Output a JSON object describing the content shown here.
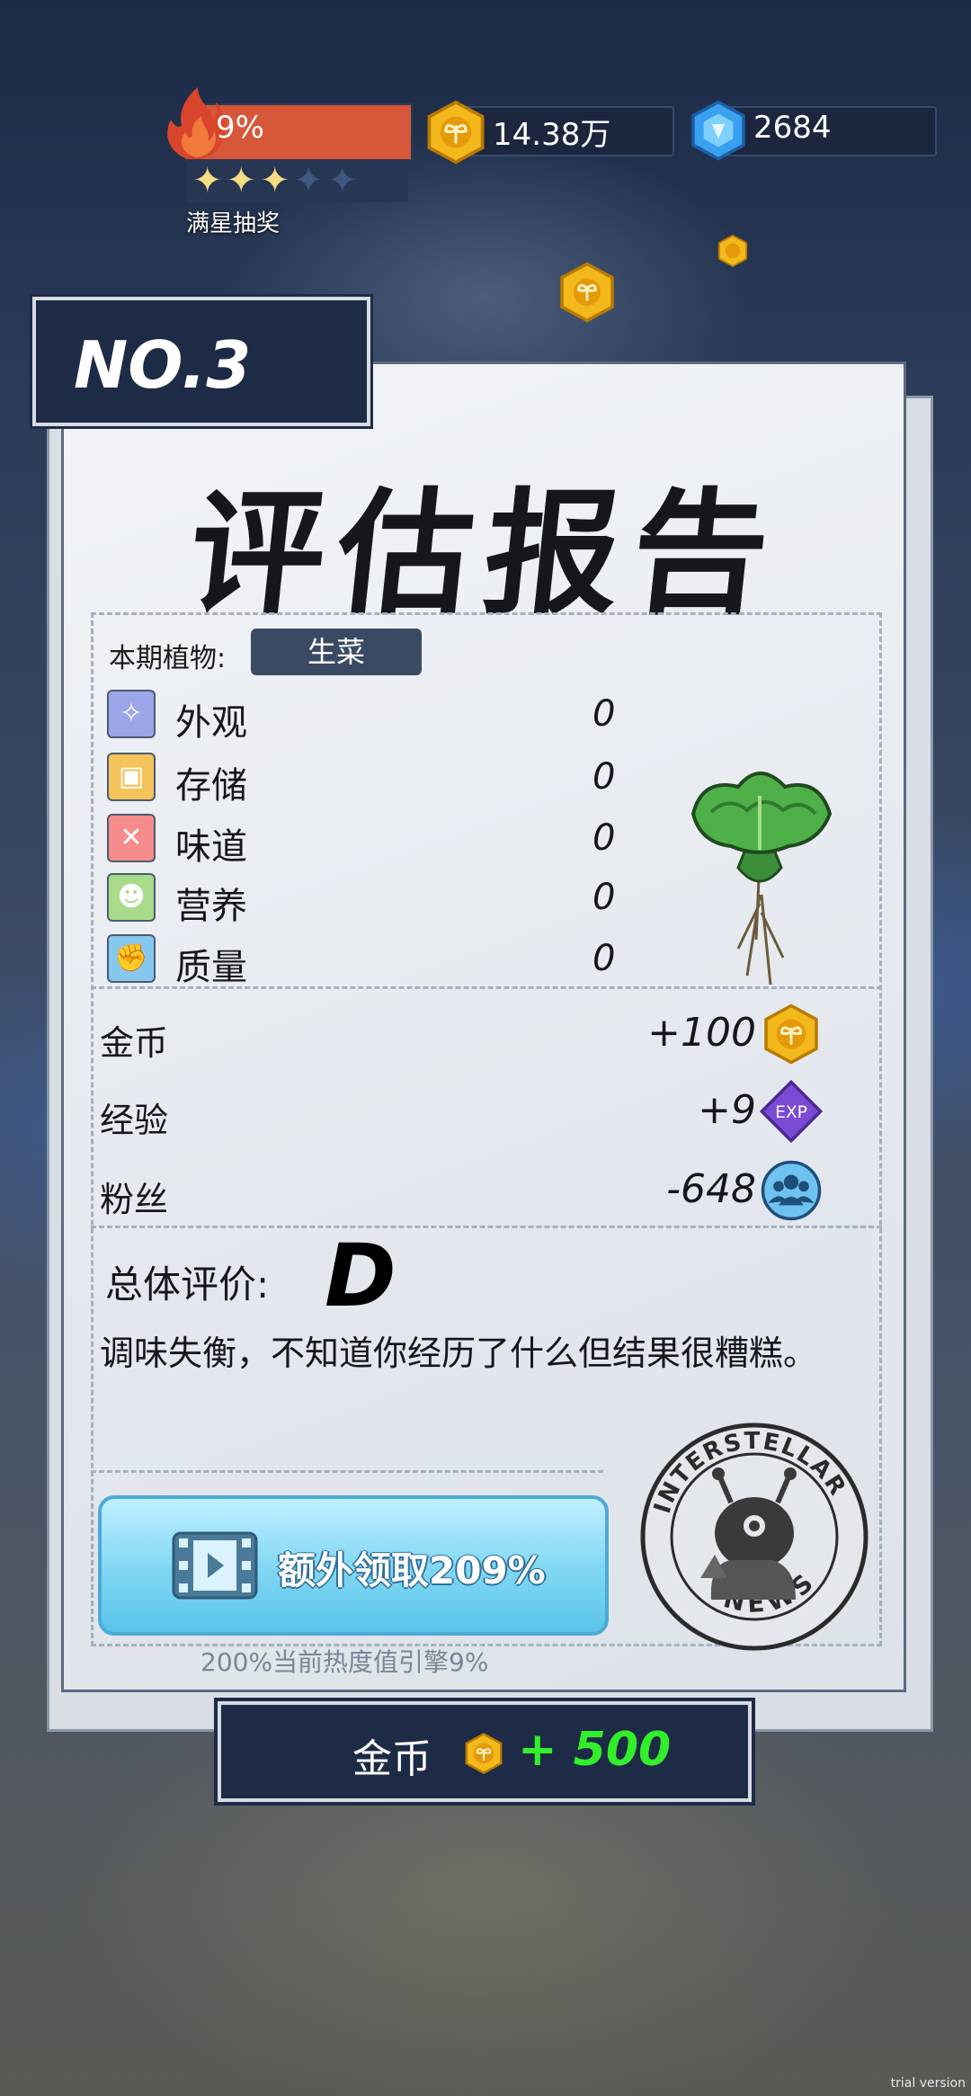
{
  "hud": {
    "heat_percent_text": "9%",
    "stars_filled": 3,
    "stars_total": 5,
    "stars_label": "满星抽奖",
    "coins_text": "14.38万",
    "gems_text": "2684"
  },
  "report": {
    "tag": "NO.3",
    "title": "评估报告",
    "plant_label": "本期植物:",
    "plant_name": "生菜",
    "stats": [
      {
        "label": "外观",
        "value": "0",
        "icon": "sparkle-icon"
      },
      {
        "label": "存储",
        "value": "0",
        "icon": "box-icon"
      },
      {
        "label": "味道",
        "value": "0",
        "icon": "utensils-icon"
      },
      {
        "label": "营养",
        "value": "0",
        "icon": "frog-icon"
      },
      {
        "label": "质量",
        "value": "0",
        "icon": "muscle-icon"
      }
    ],
    "rewards": [
      {
        "label": "金币",
        "value": "+100",
        "icon": "coin-icon"
      },
      {
        "label": "经验",
        "value": "+9",
        "icon": "exp-icon",
        "icon_text": "EXP"
      },
      {
        "label": "粉丝",
        "value": "-648",
        "icon": "fans-icon"
      }
    ],
    "overall_label": "总体评价:",
    "grade": "D",
    "comment": "调味失衡，不知道你经历了什么但结果很糟糕。",
    "ad_button": "额外领取209%",
    "ad_note": "200%当前热度值引擎9%",
    "stamp_top": "INTERSTELLAR",
    "stamp_bottom": "NEWS"
  },
  "bottom": {
    "label": "金币",
    "value": "+ 500"
  },
  "watermark": "trial version",
  "colors": {
    "panel_dark": "#1e2b46",
    "coin_gold": "#f2b81c",
    "gem_blue": "#3aa0f0",
    "heat_red": "#d6573a",
    "reward_green": "#33ee2a",
    "exp_purple": "#7b4bd6"
  }
}
